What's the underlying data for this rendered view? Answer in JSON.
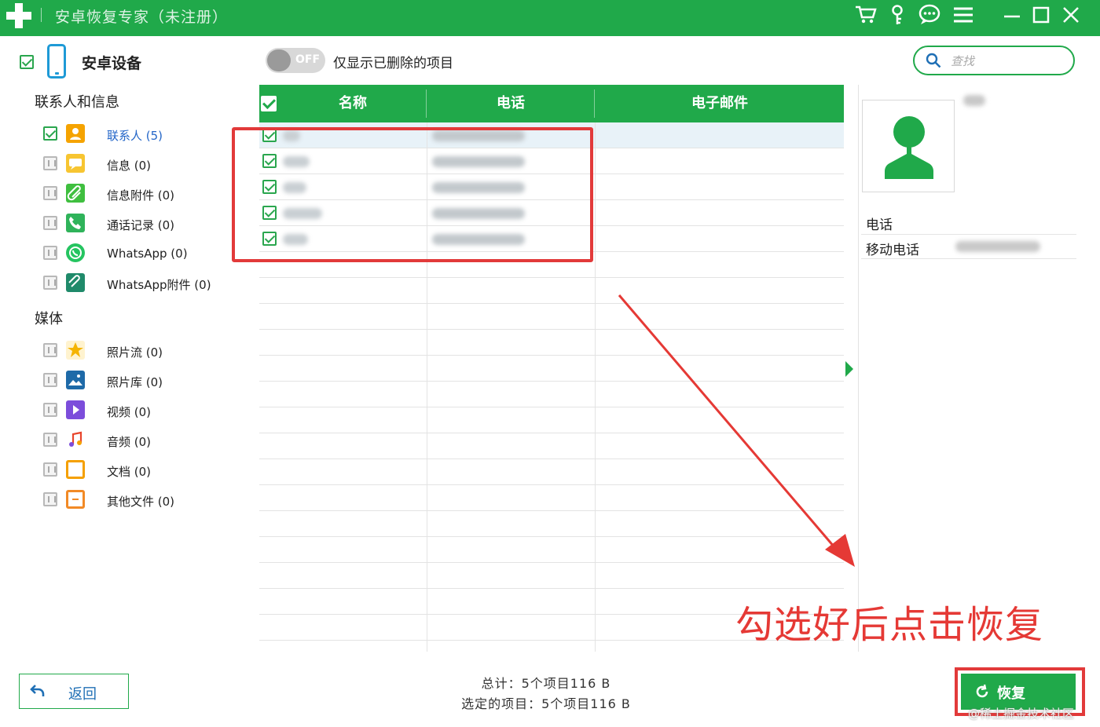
{
  "window": {
    "title": "安卓恢复专家（未注册）"
  },
  "sidebar": {
    "device_label": "安卓设备",
    "sections": [
      {
        "label": "联系人和信息",
        "items": [
          {
            "label": "联系人 (5)",
            "checked": true,
            "icon": "contact-icon",
            "color": "#f5a300"
          },
          {
            "label": "信息 (0)",
            "checked": false,
            "icon": "message-icon",
            "color": "#f7c531"
          },
          {
            "label": "信息附件 (0)",
            "checked": false,
            "icon": "attachment-icon",
            "color": "#3fbf3f"
          },
          {
            "label": "通话记录 (0)",
            "checked": false,
            "icon": "call-log-icon",
            "color": "#2fb35a"
          },
          {
            "label": "WhatsApp (0)",
            "checked": false,
            "icon": "whatsapp-icon",
            "color": "#25c460"
          },
          {
            "label": "WhatsApp附件 (0)",
            "checked": false,
            "icon": "whatsapp-attachment-icon",
            "color": "#1f8a6a"
          }
        ]
      },
      {
        "label": "媒体",
        "items": [
          {
            "label": "照片流 (0)",
            "checked": false,
            "icon": "photo-stream-icon",
            "color": "#f5b400"
          },
          {
            "label": "照片库 (0)",
            "checked": false,
            "icon": "photo-library-icon",
            "color": "#1e6aa8"
          },
          {
            "label": "视频 (0)",
            "checked": false,
            "icon": "video-icon",
            "color": "#7c4ddb"
          },
          {
            "label": "音频 (0)",
            "checked": false,
            "icon": "audio-icon",
            "color": "#e8452c"
          },
          {
            "label": "文档 (0)",
            "checked": false,
            "icon": "document-icon",
            "color": "#f5a000"
          },
          {
            "label": "其他文件 (0)",
            "checked": false,
            "icon": "other-files-icon",
            "color": "#f28a26"
          }
        ]
      }
    ]
  },
  "toolbar": {
    "toggle_state": "OFF",
    "toggle_label": "仅显示已删除的项目",
    "search_placeholder": "查找"
  },
  "table": {
    "columns": [
      "名称",
      "电话",
      "电子邮件"
    ],
    "rows": [
      {
        "checked": true
      },
      {
        "checked": true
      },
      {
        "checked": true
      },
      {
        "checked": true
      },
      {
        "checked": true
      }
    ]
  },
  "detail": {
    "phone_section": "电话",
    "mobile_label": "移动电话"
  },
  "annotation": {
    "text": "勾选好后点击恢复"
  },
  "footer": {
    "back_label": "返回",
    "total": "总计：5个项目116 B",
    "selected": "选定的项目：5个项目116 B",
    "recover_label": "恢复"
  },
  "watermark": "@稀土掘金技术社区",
  "colors": {
    "brand_green": "#20a94a",
    "annotation_red": "#e23a3a",
    "link_blue": "#2466c8"
  }
}
